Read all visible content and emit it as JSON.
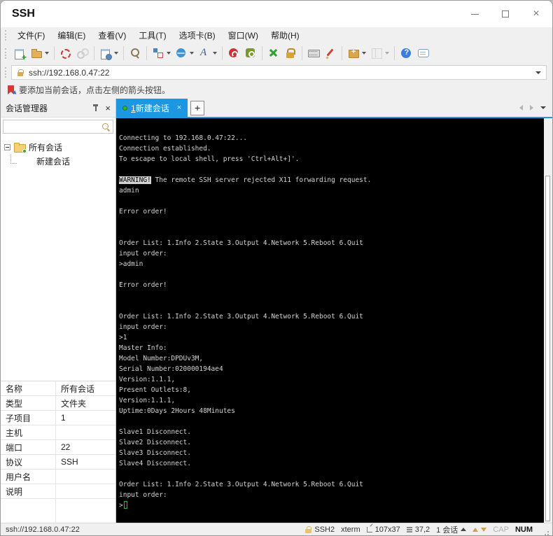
{
  "window": {
    "title": "SSH"
  },
  "menu": {
    "items": [
      "文件(F)",
      "编辑(E)",
      "查看(V)",
      "工具(T)",
      "选项卡(B)",
      "窗口(W)",
      "帮助(H)"
    ]
  },
  "toolbar": {
    "items": [
      {
        "icon": "new-session"
      },
      {
        "icon": "open-session",
        "dd": true
      },
      {
        "sep": true
      },
      {
        "icon": "disconnect"
      },
      {
        "icon": "reconnect",
        "disabled": true
      },
      {
        "sep": true
      },
      {
        "icon": "session-properties",
        "dd": true
      },
      {
        "sep": true
      },
      {
        "icon": "find"
      },
      {
        "sep": true
      },
      {
        "icon": "compose",
        "dd": true
      },
      {
        "icon": "web",
        "dd": true
      },
      {
        "icon": "font",
        "dd": true
      },
      {
        "sep": true
      },
      {
        "icon": "color-scheme"
      },
      {
        "icon": "encoding"
      },
      {
        "sep": true
      },
      {
        "icon": "fullscreen"
      },
      {
        "icon": "lock-screen"
      },
      {
        "sep": true
      },
      {
        "icon": "virtual-keyboard"
      },
      {
        "icon": "quick-command"
      },
      {
        "sep": true
      },
      {
        "icon": "new-terminal",
        "dd": true
      },
      {
        "icon": "layout",
        "dd": true,
        "disabled": true
      },
      {
        "sep": true
      },
      {
        "icon": "help"
      },
      {
        "icon": "feedback"
      }
    ]
  },
  "address_bar": {
    "value": "ssh://192.168.0.47:22"
  },
  "notice": {
    "text": "要添加当前会话，点击左侧的箭头按钮。"
  },
  "session_manager": {
    "title": "会话管理器",
    "search_placeholder": "",
    "tree": {
      "root_label": "所有会话",
      "child_label": "新建会话"
    }
  },
  "tabs": {
    "active_index": "1",
    "active_label": "新建会话",
    "close_label": "×",
    "new_tab_label": "+"
  },
  "terminal": {
    "colors": {
      "background": "#000000",
      "foreground": "#d4d4d4",
      "cursor": "#00cc33"
    },
    "lines": [
      {
        "t": "Connecting to 192.168.0.47:22..."
      },
      {
        "t": "Connection established."
      },
      {
        "t": "To escape to local shell, press 'Ctrl+Alt+]'."
      },
      {
        "t": ""
      },
      {
        "inv": "WARNING!",
        "t": " The remote SSH server rejected X11 forwarding request."
      },
      {
        "t": "admin"
      },
      {
        "t": ""
      },
      {
        "t": "Error order!"
      },
      {
        "t": ""
      },
      {
        "t": ""
      },
      {
        "t": "Order List: 1.Info 2.State 3.Output 4.Network 5.Reboot 6.Quit"
      },
      {
        "t": "input order:"
      },
      {
        "t": ">admin"
      },
      {
        "t": ""
      },
      {
        "t": "Error order!"
      },
      {
        "t": ""
      },
      {
        "t": ""
      },
      {
        "t": "Order List: 1.Info 2.State 3.Output 4.Network 5.Reboot 6.Quit"
      },
      {
        "t": "input order:"
      },
      {
        "t": ">1"
      },
      {
        "t": "Master Info:"
      },
      {
        "t": "Model Number:DPDUv3M,"
      },
      {
        "t": "Serial Number:020000194ae4"
      },
      {
        "t": "Version:1.1.1,"
      },
      {
        "t": "Present Outlets:8,"
      },
      {
        "t": "Version:1.1.1,"
      },
      {
        "t": "Uptime:0Days 2Hours 48Minutes"
      },
      {
        "t": ""
      },
      {
        "t": "Slave1 Disconnect."
      },
      {
        "t": "Slave2 Disconnect."
      },
      {
        "t": "Slave3 Disconnect."
      },
      {
        "t": "Slave4 Disconnect."
      },
      {
        "t": ""
      },
      {
        "t": "Order List: 1.Info 2.State 3.Output 4.Network 5.Reboot 6.Quit"
      },
      {
        "t": "input order:"
      },
      {
        "t": ">",
        "cursor": true
      }
    ]
  },
  "properties": {
    "rows": [
      {
        "label": "名称",
        "value": "所有会话"
      },
      {
        "label": "类型",
        "value": "文件夹"
      },
      {
        "label": "子项目",
        "value": "1"
      },
      {
        "label": "主机",
        "value": ""
      },
      {
        "label": "端口",
        "value": "22"
      },
      {
        "label": "协议",
        "value": "SSH"
      },
      {
        "label": "用户名",
        "value": ""
      },
      {
        "label": "说明",
        "value": ""
      }
    ]
  },
  "status_bar": {
    "left": "ssh://192.168.0.47:22",
    "encryption": "SSH2",
    "terminal_type": "xterm",
    "size": "107x37",
    "cursor_pos": "37,2",
    "session_count": "1 会话",
    "cap": "CAP",
    "num": "NUM"
  },
  "colors": {
    "accent": "#1e97e2",
    "tab_dot": "#33b533",
    "terminal_fg": "#d4d4d4"
  }
}
